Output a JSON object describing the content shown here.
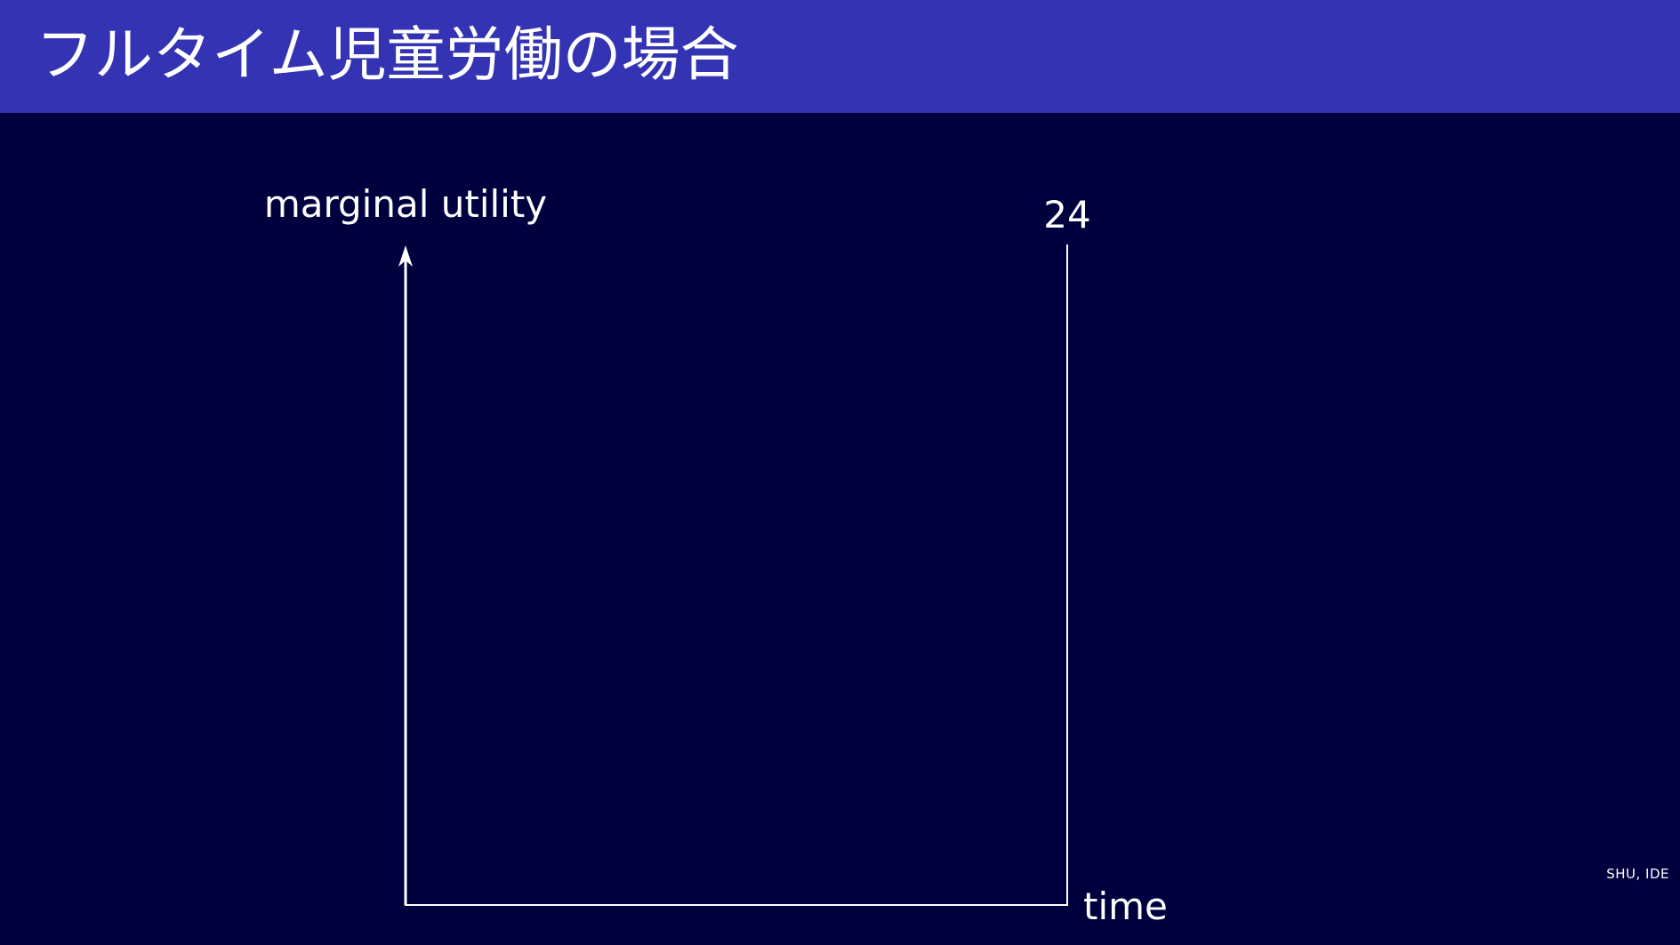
{
  "slide": {
    "title": "フルタイム児童労働の場合",
    "footer": "SHU, IDE"
  },
  "diagram": {
    "y_axis_label": "marginal utility",
    "x_axis_label": "time",
    "right_boundary_label": "24"
  },
  "colors": {
    "header_bar": "#3333b3",
    "background": "#00003f",
    "foreground": "#ffffff"
  }
}
